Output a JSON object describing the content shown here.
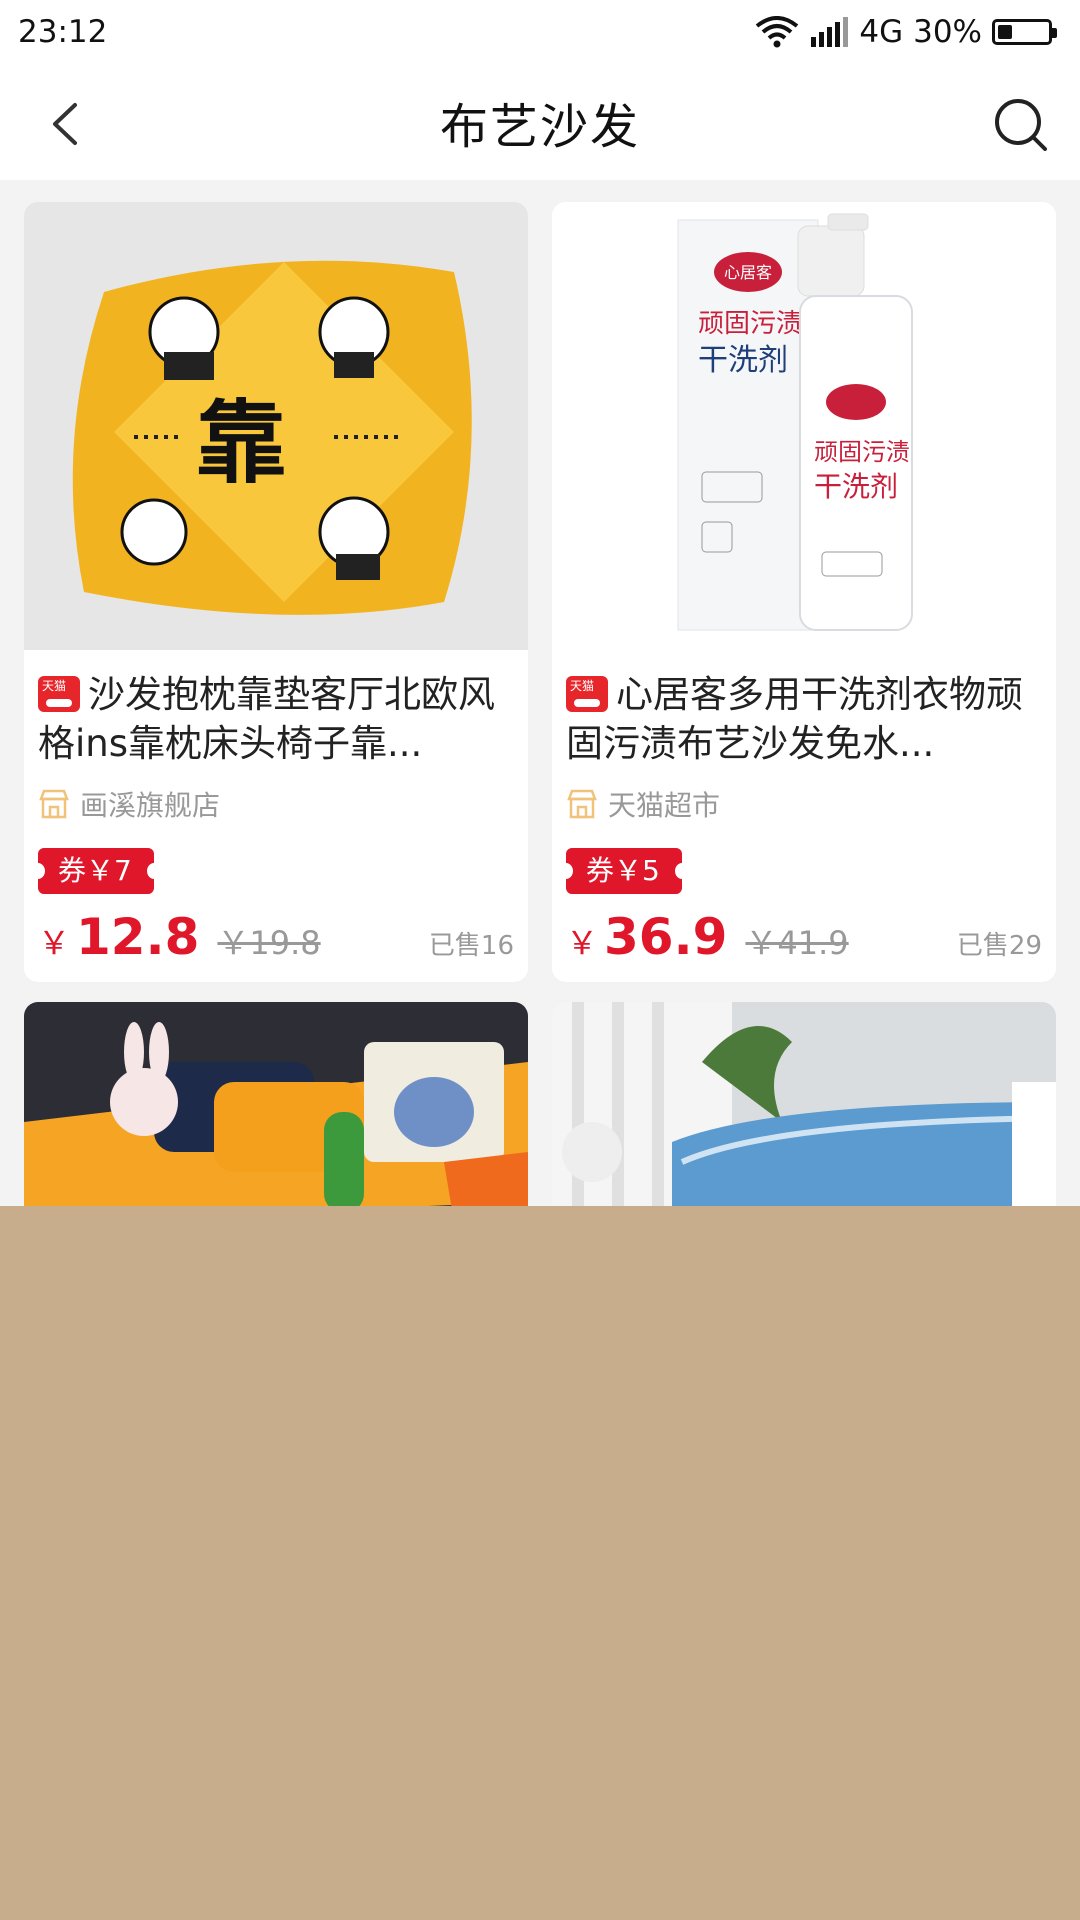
{
  "status_bar": {
    "time": "23:12",
    "network": "4G",
    "battery": "30%",
    "battery_level": 0.3
  },
  "nav": {
    "title": "布艺沙发"
  },
  "products": [
    {
      "badge": "天猫",
      "title": "沙发抱枕靠垫客厅北欧风格ins靠枕床头椅子靠...",
      "shop": "画溪旗舰店",
      "coupon": "券￥7",
      "price_symbol": "￥",
      "price": "12.8",
      "original_price": "￥19.8",
      "sold": "已售16",
      "image_text": "靠"
    },
    {
      "badge": "天猫",
      "title": "心居客多用干洗剂衣物顽固污渍布艺沙发免水...",
      "shop": "天猫超市",
      "coupon": "券￥5",
      "price_symbol": "￥",
      "price": "36.9",
      "original_price": "￥41.9",
      "sold": "已售29",
      "image_brand": "心居客",
      "image_label_1": "顽固污渍",
      "image_label_2": "干洗剂"
    }
  ],
  "colors": {
    "accent": "#e0162b",
    "overlay": "#c8ad8c"
  }
}
